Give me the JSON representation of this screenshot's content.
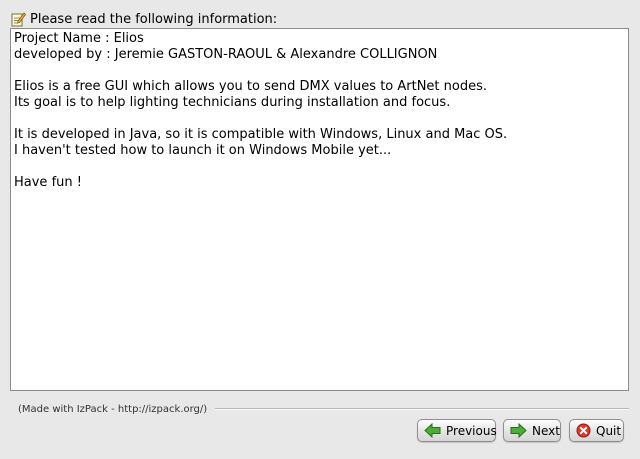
{
  "header": {
    "icon": "notepad-pencil-icon",
    "title": "Please read the following information:"
  },
  "info": {
    "text": "Project Name : Elios\ndeveloped by : Jeremie GASTON-RAOUL & Alexandre COLLIGNON\n\nElios is a free GUI which allows you to send DMX values to ArtNet nodes.\nIts goal is to help lighting technicians during installation and focus.\n\nIt is developed in Java, so it is compatible with Windows, Linux and Mac OS.\nI haven't tested how to launch it on Windows Mobile yet...\n\nHave fun !"
  },
  "footer": {
    "credit": "(Made with IzPack - http://izpack.org/)"
  },
  "buttons": {
    "previous": {
      "label": "Previous",
      "icon": "arrow-left-icon",
      "color": "#3a9a2a"
    },
    "next": {
      "label": "Next",
      "icon": "arrow-right-icon",
      "color": "#3a9a2a"
    },
    "quit": {
      "label": "Quit",
      "icon": "close-circle-icon",
      "color": "#d42a1e"
    }
  }
}
